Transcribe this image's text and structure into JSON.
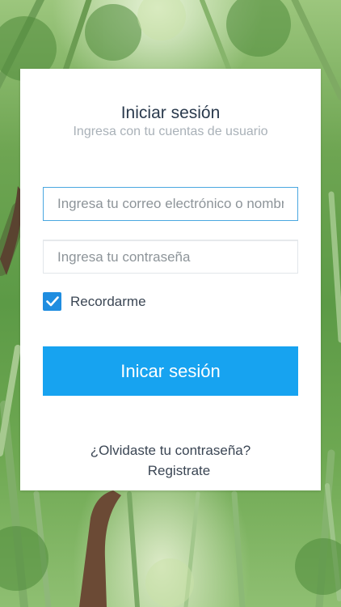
{
  "login": {
    "title": "Iniciar sesión",
    "subtitle": "Ingresa con tu cuentas de usuario",
    "email_placeholder": "Ingresa tu correo electrónico o nombre de usuario",
    "password_placeholder": "Ingresa tu contraseña",
    "remember_label": "Recordarme",
    "remember_checked": true,
    "submit_label": "Inicar sesión",
    "forgot_link": "¿Olvidaste tu contraseña?",
    "register_link": "Registrate"
  },
  "colors": {
    "primary_button": "#17a3f0",
    "checkbox": "#1f8de0",
    "focus_border": "#4aa7e0"
  }
}
